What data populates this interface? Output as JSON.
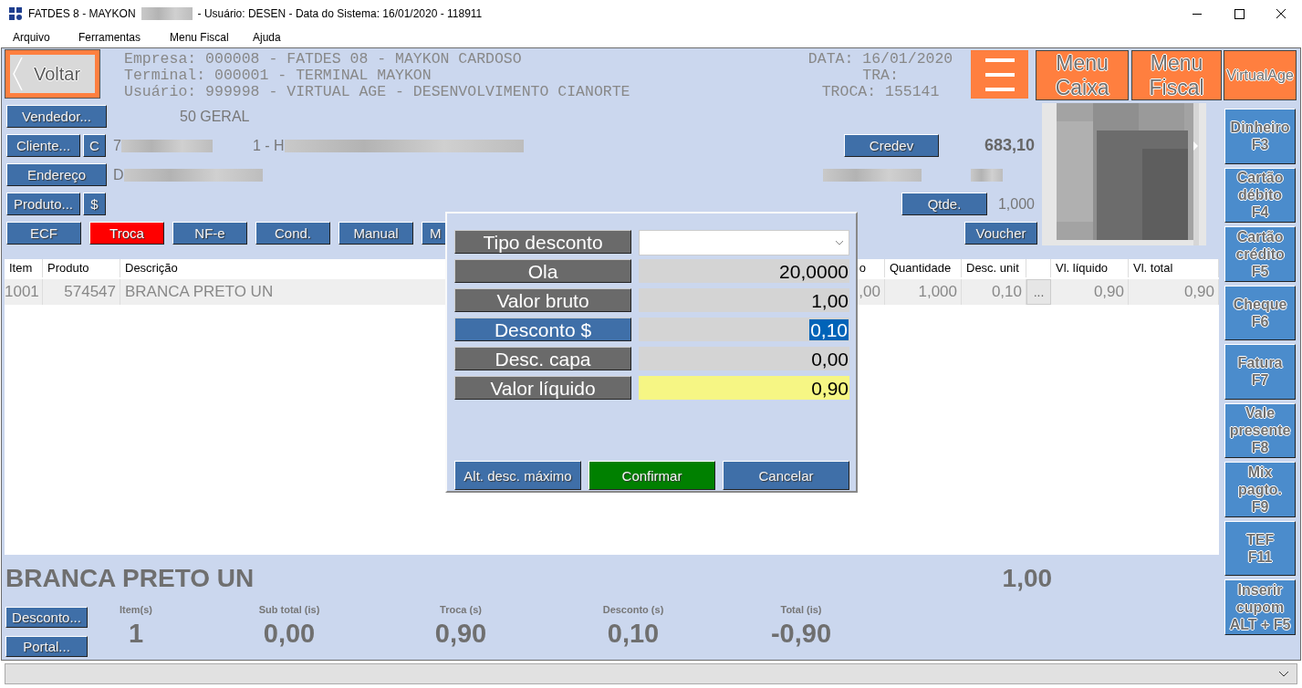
{
  "window": {
    "title_start": "FATDES 8 - MAYKON",
    "title_end": "- Usuário: DESEN - Data do Sistema: 16/01/2020 - 118911"
  },
  "menu": [
    {
      "label": "Arquivo"
    },
    {
      "label": "Ferramentas"
    },
    {
      "label": "Menu Fiscal"
    },
    {
      "label": "Ajuda"
    }
  ],
  "header": {
    "back_button": "Voltar",
    "info_lines": [
      "Empresa: 000008 - FATDES 08 - MAYKON CARDOSO",
      "Terminal: 000001 - TERMINAL MAYKON",
      "Usuário: 999998 - VIRTUAL AGE - DESENVOLVIMENTO CIANORTE"
    ],
    "date_lines": [
      "DATA: 16/01/2020",
      "TRA:",
      "TROCA: 155141"
    ],
    "menu_buttons": [
      {
        "lines": [
          "Menu",
          "Caixa"
        ]
      },
      {
        "lines": [
          "Menu",
          "Fiscal"
        ]
      }
    ],
    "brand_button": "VirtualAge"
  },
  "form": {
    "seller_button": "Vendedor...",
    "seller": "50 GERAL",
    "client_button": "Cliente...",
    "client_short_button": "C",
    "client_code": "7",
    "client_name": "1 - H",
    "credev_button": "Credev",
    "credev_amount": "683,10",
    "address_button": "Endereço",
    "address": "D",
    "product_button": "Produto...",
    "price_button": "$",
    "quantity_button": "Qtde.",
    "quantity": "1,000"
  },
  "toolbar": [
    {
      "label": "ECF",
      "selected": false
    },
    {
      "label": "Troca",
      "selected": true
    },
    {
      "label": "NF-e",
      "selected": false
    },
    {
      "label": "Cond.",
      "selected": false
    },
    {
      "label": "Manual",
      "selected": false
    },
    {
      "label": "M",
      "selected": false
    }
  ],
  "voucher_button": "Voucher",
  "table": {
    "columns": [
      {
        "label": "Item",
        "kind": "text"
      },
      {
        "label": "Produto",
        "kind": "text"
      },
      {
        "label": "Descrição",
        "kind": "text"
      },
      {
        "label": "o",
        "kind": "text"
      },
      {
        "label": "Quantidade",
        "kind": "text"
      },
      {
        "label": "Desc. unit",
        "kind": "text"
      },
      {
        "kind": "button"
      },
      {
        "label": "Vl. líquido",
        "kind": "text"
      },
      {
        "label": "Vl. total",
        "kind": "text"
      }
    ],
    "rows": [
      {
        "cells": [
          "1001",
          "574547",
          "BRANCA PRETO UN",
          ",00",
          "1,000",
          "0,10",
          "...",
          "0,90",
          "0,90"
        ]
      }
    ]
  },
  "dialog": {
    "fields": [
      {
        "label": "Tipo desconto",
        "kind": "select",
        "focused": false
      },
      {
        "label": "Ola",
        "kind": "text",
        "value": "20,0000",
        "focused": false
      },
      {
        "label": "Valor bruto",
        "kind": "text",
        "value": "1,00",
        "focused": false
      },
      {
        "label": "Desconto $",
        "kind": "text",
        "value": "0,10",
        "focused": true
      },
      {
        "label": "Desc. capa",
        "kind": "text",
        "value": "0,00",
        "focused": false
      },
      {
        "label": "Valor líquido",
        "kind": "result",
        "value": "0,90",
        "focused": false
      }
    ],
    "buttons": [
      {
        "label": "Alt. desc. máximo",
        "kind": "default"
      },
      {
        "label": "Confirmar",
        "kind": "primary"
      },
      {
        "label": "Cancelar",
        "kind": "default"
      }
    ]
  },
  "current_item": {
    "description": "BRANCA PRETO UN",
    "price": "1,00"
  },
  "footer_buttons": [
    "Desconto...",
    "Portal..."
  ],
  "totals": [
    {
      "label": "Item(s)",
      "value": "1"
    },
    {
      "label": "Sub total (is)",
      "value": "0,00"
    },
    {
      "label": "Troca (s)",
      "value": "0,90"
    },
    {
      "label": "Desconto (s)",
      "value": "0,10"
    },
    {
      "label": "Total (is)",
      "value": "-0,90"
    }
  ],
  "payment_buttons": [
    {
      "lines": [
        "Dinheiro",
        "F3"
      ]
    },
    {
      "lines": [
        "Cartão",
        "débito",
        "F4"
      ]
    },
    {
      "lines": [
        "Cartão",
        "crédito",
        "F5"
      ]
    },
    {
      "lines": [
        "Cheque",
        "F6"
      ]
    },
    {
      "lines": [
        "Fatura",
        "F7"
      ]
    },
    {
      "lines": [
        "Vale",
        "presente",
        "F8"
      ]
    },
    {
      "lines": [
        "Mix",
        "pagto.",
        "F9"
      ]
    },
    {
      "lines": [
        "TEF",
        "F11"
      ]
    },
    {
      "lines": [
        "Inserir",
        "cupom",
        "ALT + F5"
      ]
    }
  ]
}
